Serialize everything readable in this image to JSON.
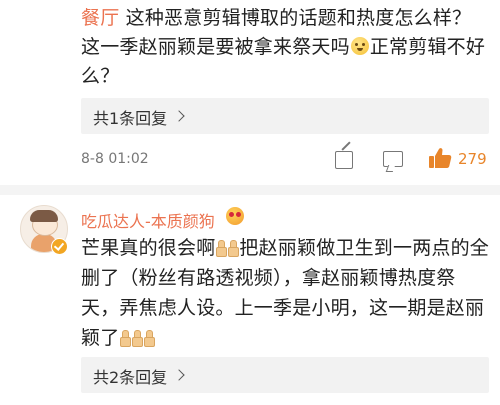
{
  "comment1": {
    "mention": "餐厅",
    "text_line1": " 这种恶意剪辑博取的话题和热度怎么样？",
    "text_line2a": "这一季赵丽颖是要被拿来祭天吗",
    "text_line2b": "正常剪辑不好",
    "text_line3": "么？",
    "emoji_icon": "awkward-face-icon",
    "replies_label": "共1条回复",
    "time": "8-8 01:02",
    "like_count": "279"
  },
  "comment2": {
    "username": "吃瓜达人-本质颜狗",
    "badge_icon": "fan-badge-icon",
    "text_part1": "芒果真的很会啊",
    "text_part2": "把赵丽颖做卫生到一两点的全删了（粉丝有路透视频），拿赵丽颖博热度祭天，弄焦虑人设。上一季是小明，这一期是赵丽颖了",
    "replies_label": "共2条回复"
  },
  "colors": {
    "mention": "#eb7350",
    "like": "#e8852a",
    "reply_bg": "#f2f2f2",
    "divider": "#f4f4f4"
  }
}
